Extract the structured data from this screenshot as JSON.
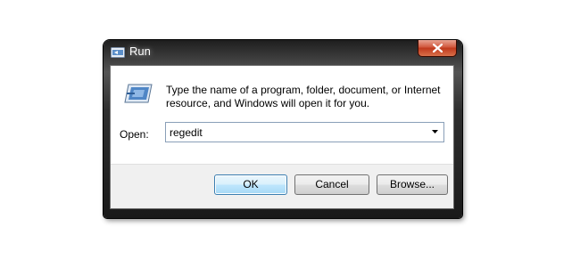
{
  "window": {
    "title": "Run",
    "close_label": "Close"
  },
  "dialog": {
    "description": "Type the name of a program, folder, document, or Internet resource, and Windows will open it for you.",
    "open_label": "Open:",
    "open_value": "regedit"
  },
  "buttons": {
    "ok_label": "OK",
    "cancel_label": "Cancel",
    "browse_label": "Browse..."
  },
  "icons": {
    "title": "run-icon",
    "main": "run-icon",
    "close": "close-icon",
    "dropdown": "chevron-down-icon"
  },
  "colors": {
    "title_bar": "#2e2e2e",
    "close_button": "#c0391c",
    "default_button_border": "#3c7fb1",
    "dialog_background": "#f0f0f0"
  }
}
